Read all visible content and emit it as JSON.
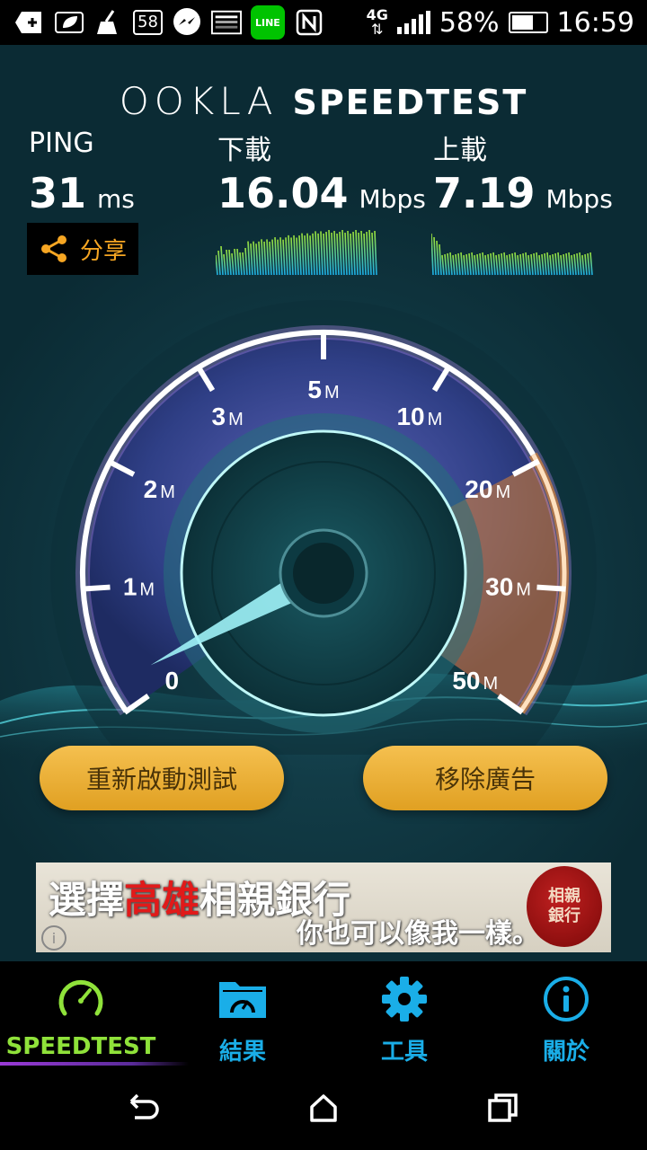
{
  "status_bar": {
    "notif_count": "58",
    "line_label": "LINE",
    "network": "4G",
    "battery_percent": "58%",
    "time": "16:59"
  },
  "header": {
    "brand": "OOKLA",
    "product": "SPEEDTEST"
  },
  "stats": {
    "ping": {
      "label": "PING",
      "value": "31",
      "unit": "ms"
    },
    "download": {
      "label": "下載",
      "value": "16.04",
      "unit": "Mbps"
    },
    "upload": {
      "label": "上載",
      "value": "7.19",
      "unit": "Mbps"
    }
  },
  "share": {
    "label": "分享"
  },
  "gauge": {
    "ticks": [
      {
        "num": "0",
        "unit": ""
      },
      {
        "num": "1",
        "unit": "M"
      },
      {
        "num": "2",
        "unit": "M"
      },
      {
        "num": "3",
        "unit": "M"
      },
      {
        "num": "5",
        "unit": "M"
      },
      {
        "num": "10",
        "unit": "M"
      },
      {
        "num": "20",
        "unit": "M"
      },
      {
        "num": "30",
        "unit": "M"
      },
      {
        "num": "50",
        "unit": "M"
      }
    ],
    "colors": {
      "ring": "#b48cf0",
      "highlight": "#f08a2a",
      "needle": "#9ff2f7"
    }
  },
  "buttons": {
    "restart": "重新啟動測試",
    "remove_ads": "移除廣告"
  },
  "ad": {
    "line1_a": "選擇",
    "line1_highlight": "高雄",
    "line1_b": "相親銀行",
    "line2": "你也可以像我一樣。",
    "seal": "相親銀行",
    "info": "i"
  },
  "tabs": [
    {
      "label": "SPEEDTEST",
      "icon": "speedometer-icon",
      "active": true
    },
    {
      "label": "結果",
      "icon": "results-folder-icon",
      "active": false
    },
    {
      "label": "工具",
      "icon": "gear-icon",
      "active": false
    },
    {
      "label": "關於",
      "icon": "info-icon",
      "active": false
    }
  ]
}
